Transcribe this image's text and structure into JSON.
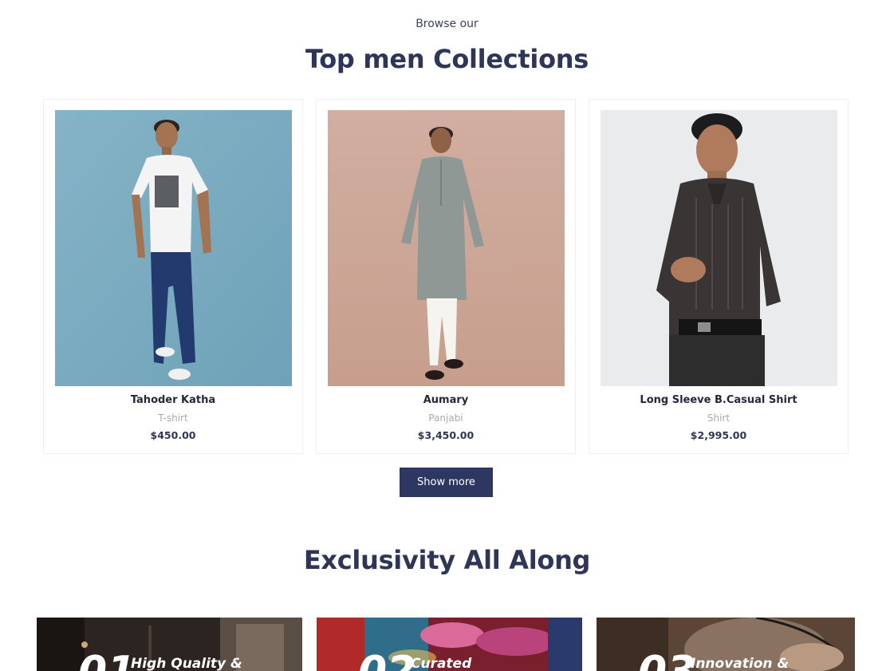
{
  "collection": {
    "eyebrow": "Browse our",
    "title": "Top men Collections",
    "products": [
      {
        "name": "Tahoder Katha",
        "category": "T-shirt",
        "price": "$450.00"
      },
      {
        "name": "Aumary",
        "category": "Panjabi",
        "price": "$3,450.00"
      },
      {
        "name": "Long Sleeve B.Casual Shirt",
        "category": "Shirt",
        "price": "$2,995.00"
      }
    ],
    "show_more_label": "Show more"
  },
  "exclusivity": {
    "title": "Exclusivity All Along",
    "features": [
      {
        "number": "01",
        "label": "High Quality &"
      },
      {
        "number": "02",
        "label": "Curated"
      },
      {
        "number": "03",
        "label": "Innovation &"
      }
    ]
  },
  "colors": {
    "brand": "#2e3762",
    "heading": "#2e3558",
    "muted": "#a9a9a9"
  }
}
